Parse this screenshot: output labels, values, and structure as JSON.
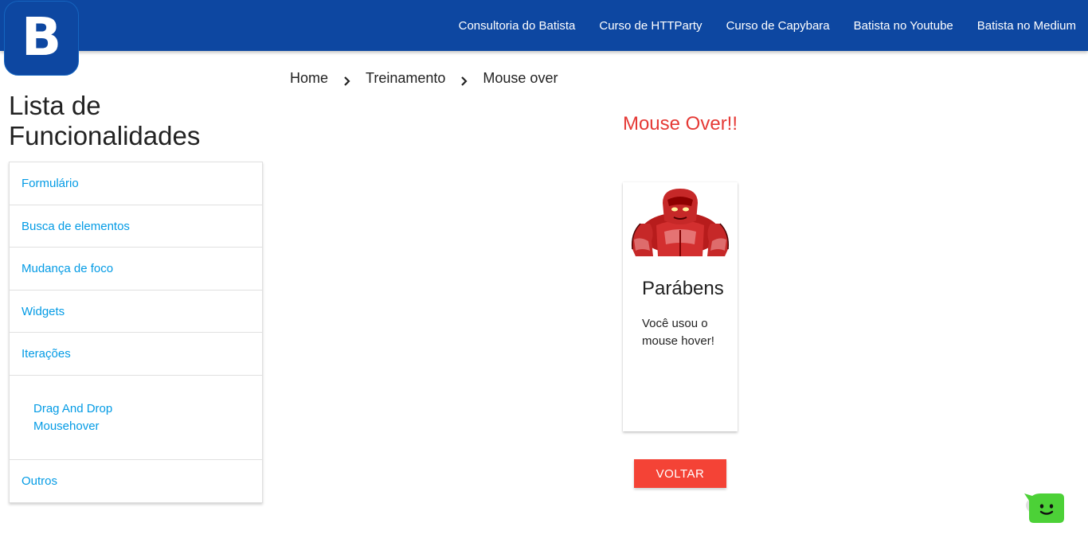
{
  "header": {
    "logo_letter": "B",
    "nav": [
      "Consultoria do Batista",
      "Curso de HTTParty",
      "Curso de Capybara",
      "Batista no Youtube",
      "Batista no Medium"
    ]
  },
  "breadcrumb": [
    "Home",
    "Treinamento",
    "Mouse over"
  ],
  "sidebar": {
    "title": "Lista de Funcionalidades",
    "items": [
      "Formulário",
      "Busca de elementos",
      "Mudança de foco",
      "Widgets",
      "Iterações"
    ],
    "sub_items": [
      "Drag And Drop",
      "Mousehover"
    ],
    "last_item": "Outros"
  },
  "main": {
    "title": "Mouse Over!!",
    "card": {
      "image_icon": "juggernaut-illustration",
      "title": "Parábens",
      "text": "Você usou o mouse hover!"
    },
    "button_label": "VOLTAR"
  },
  "chat": {
    "icon": "smiley-chat-icon"
  },
  "colors": {
    "header": "#0d47a1",
    "link": "#039be5",
    "title_red": "#e53935",
    "button_red": "#f44336",
    "chat_green": "#4cd137"
  }
}
